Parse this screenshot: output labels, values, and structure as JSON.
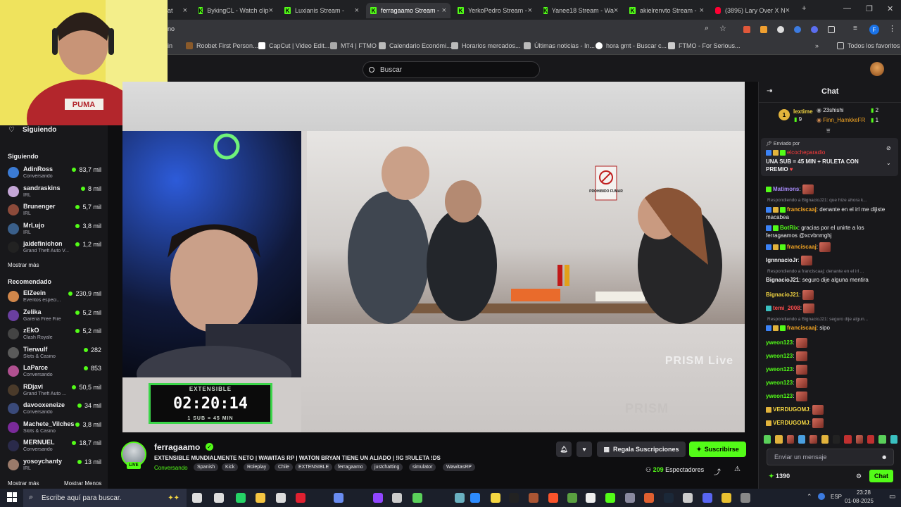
{
  "browser": {
    "tabs": [
      {
        "title": "at",
        "active": false,
        "partial": true
      },
      {
        "title": "BykingCL - Watch clip",
        "active": false
      },
      {
        "title": "Luxianis Stream - ",
        "active": false
      },
      {
        "title": "ferragaamo Stream - ",
        "active": true
      },
      {
        "title": "YerkoPedro Stream - ",
        "active": false
      },
      {
        "title": "Yanee18 Stream - Wa",
        "active": false
      },
      {
        "title": "akielrenvto Stream - ",
        "active": false
      },
      {
        "title": "(3896) Lary Over X N",
        "active": false
      }
    ],
    "address_fragment": "no",
    "bookmarks": [
      "Roobet First Person...",
      "CapCut | Video Edit...",
      "MT4 | FTMO",
      "Calendario Económi...",
      "Horarios mercados...",
      "Últimas noticias - In...",
      "hora gmt - Buscar c...",
      "FTMO - For Serious..."
    ],
    "all_bookmarks_label": "Todos los favoritos"
  },
  "header": {
    "search_placeholder": "Buscar"
  },
  "sidebar": {
    "following_header": "Siguiendo",
    "following_label": "Siguiendo",
    "following": [
      {
        "name": "AdinRoss",
        "category": "Conversando",
        "viewers": "83,7 mil",
        "color": "#3b7bd4"
      },
      {
        "name": "sandraskins",
        "category": "IRL",
        "viewers": "8 mil",
        "color": "#c4a6d6"
      },
      {
        "name": "Brunenger",
        "category": "IRL",
        "viewers": "5,7 mil",
        "color": "#8c4a3a"
      },
      {
        "name": "MrLujo",
        "category": "IRL",
        "viewers": "3,8 mil",
        "color": "#3a5f8a"
      },
      {
        "name": "jaidefinichon",
        "category": "Grand Theft Auto V...",
        "viewers": "1,2 mil",
        "color": "#222"
      }
    ],
    "show_more": "Mostrar más",
    "recommended_label": "Recomendado",
    "recommended": [
      {
        "name": "ElZeein",
        "category": "Eventos especi...",
        "viewers": "230,9 mil",
        "color": "#d0864a"
      },
      {
        "name": "Zelika",
        "category": "Garena Free Fire",
        "viewers": "5,2 mil",
        "color": "#6a3fa0"
      },
      {
        "name": "zEkO",
        "category": "Clash Royale",
        "viewers": "5,2 mil",
        "color": "#444"
      },
      {
        "name": "Tierwulf",
        "category": "Slots & Casino",
        "viewers": "282",
        "color": "#5a5a5a"
      },
      {
        "name": "LaParce",
        "category": "Conversando",
        "viewers": "853",
        "color": "#b05090"
      },
      {
        "name": "RDjavi",
        "category": "Grand Theft Auto ...",
        "viewers": "50,5 mil",
        "color": "#4a3a2a"
      },
      {
        "name": "davooxeneize",
        "category": "Conversando",
        "viewers": "34 mil",
        "color": "#3a4a7a"
      },
      {
        "name": "Machete_Vilches",
        "category": "Slots & Casino",
        "viewers": "3,8 mil",
        "color": "#7a2a9a"
      },
      {
        "name": "MERNUEL",
        "category": "Conversando",
        "viewers": "18,7 mil",
        "color": "#2a2a4a"
      },
      {
        "name": "yosoychanty",
        "category": "IRL",
        "viewers": "13 mil",
        "color": "#9a7a6a"
      }
    ],
    "show_more_bottom": "Mostrar más",
    "show_less": "Mostrar Menos"
  },
  "player": {
    "timer_top": "EXTENSIBLE",
    "timer": "02:20:14",
    "timer_bottom": "1 SUB = 45 MIN",
    "sign_text": "PROHIBIDO FUMAR",
    "watermark": "PRISM Live",
    "watermark2": "PRISM"
  },
  "stream": {
    "streamer": "ferragaamo",
    "live": "LIVE",
    "title": "EXTENSIBLE MUNDIALMENTE NETO | WAWITAS RP | WATON BRYAN TIENE UN ALIADO | !IG !RULETA !DS",
    "category": "Conversando",
    "tags": [
      "Spanish",
      "Kick",
      "Roleplay",
      "Chile",
      "EXTENSIBLE",
      "ferragaamo",
      "justchatting",
      "simulator",
      "WawitasRP"
    ],
    "gift_button": "Regala Suscripciones",
    "subscribe_button": "Suscribirse",
    "viewers_count": "209",
    "viewers_label": "Espectadores"
  },
  "chat": {
    "header": "Chat",
    "leaderboard": [
      {
        "name": "lextime",
        "value": "9",
        "rank": "1"
      },
      {
        "name": "23shishi",
        "value": "2"
      },
      {
        "name": "Finn_HamkkeFR",
        "value": "1"
      }
    ],
    "pinned_by_label": "Enviado por",
    "pinned_by": "elcocheparadio",
    "pinned_message": "UNA SUB = 45 MIN + RULETA CON PREMIO",
    "messages": [
      {
        "type": "msg",
        "user": "Matimons",
        "text": "",
        "color": "#a78bfa",
        "emote": true
      },
      {
        "type": "reply",
        "text": "Respondiendo a BignacioJ21: que hize ahora k..."
      },
      {
        "type": "msg",
        "user": "franciscaaj",
        "text": "denante en el irl me dijiste macabea",
        "color": "#f5a623"
      },
      {
        "type": "msg",
        "user": "BotRix",
        "text": "gracias por el unirte a los ferragaamos @xcvbnmghj",
        "color": "#53fc18"
      },
      {
        "type": "msg",
        "user": "franciscaaj",
        "text": "",
        "color": "#f5a623",
        "emote": true
      },
      {
        "type": "msg",
        "user": "IgnnnacioJr",
        "text": "",
        "color": "#efeff1",
        "emote": true
      },
      {
        "type": "reply",
        "text": "Respondiendo a franciscaaj: denante en el irl ..."
      },
      {
        "type": "msg",
        "user": "BignacioJ21",
        "text": "seguro dije alguna mentira",
        "color": "#efeff1"
      },
      {
        "type": "msg",
        "user": "BignacioJ21",
        "text": "",
        "color": "#f5d742",
        "emote": true
      },
      {
        "type": "msg",
        "user": "temi_2008",
        "text": "",
        "color": "#ff4d4d",
        "emote": true
      },
      {
        "type": "reply",
        "text": "Respondiendo a BignacioJ21: seguro dije algun..."
      },
      {
        "type": "msg",
        "user": "franciscaaj",
        "text": "sipo",
        "color": "#f5a623"
      },
      {
        "type": "msg",
        "user": "yweon123",
        "text": "",
        "color": "#53fc18",
        "emote": true
      },
      {
        "type": "msg",
        "user": "yweon123",
        "text": "",
        "color": "#53fc18",
        "emote": true
      },
      {
        "type": "msg",
        "user": "yweon123",
        "text": "",
        "color": "#53fc18",
        "emote": true
      },
      {
        "type": "msg",
        "user": "yweon123",
        "text": "",
        "color": "#53fc18",
        "emote": true
      },
      {
        "type": "msg",
        "user": "yweon123",
        "text": "",
        "color": "#53fc18",
        "emote": true
      },
      {
        "type": "msg",
        "user": "VERDUGOMJ",
        "text": "",
        "color": "#f5d742",
        "emote": true
      },
      {
        "type": "msg",
        "user": "VERDUGOMJ",
        "text": "",
        "color": "#f5d742",
        "emote": true
      }
    ],
    "input_placeholder": "Enviar un mensaje",
    "points": "1390",
    "send_button": "Chat"
  },
  "taskbar": {
    "search_placeholder": "Escribe aquí para buscar.",
    "lang": "ESP",
    "time": "23:28",
    "date": "01-08-2025"
  },
  "colors": {
    "kick_green": "#53fc18",
    "bg_dark": "#0e0e10",
    "panel": "#18181b"
  }
}
